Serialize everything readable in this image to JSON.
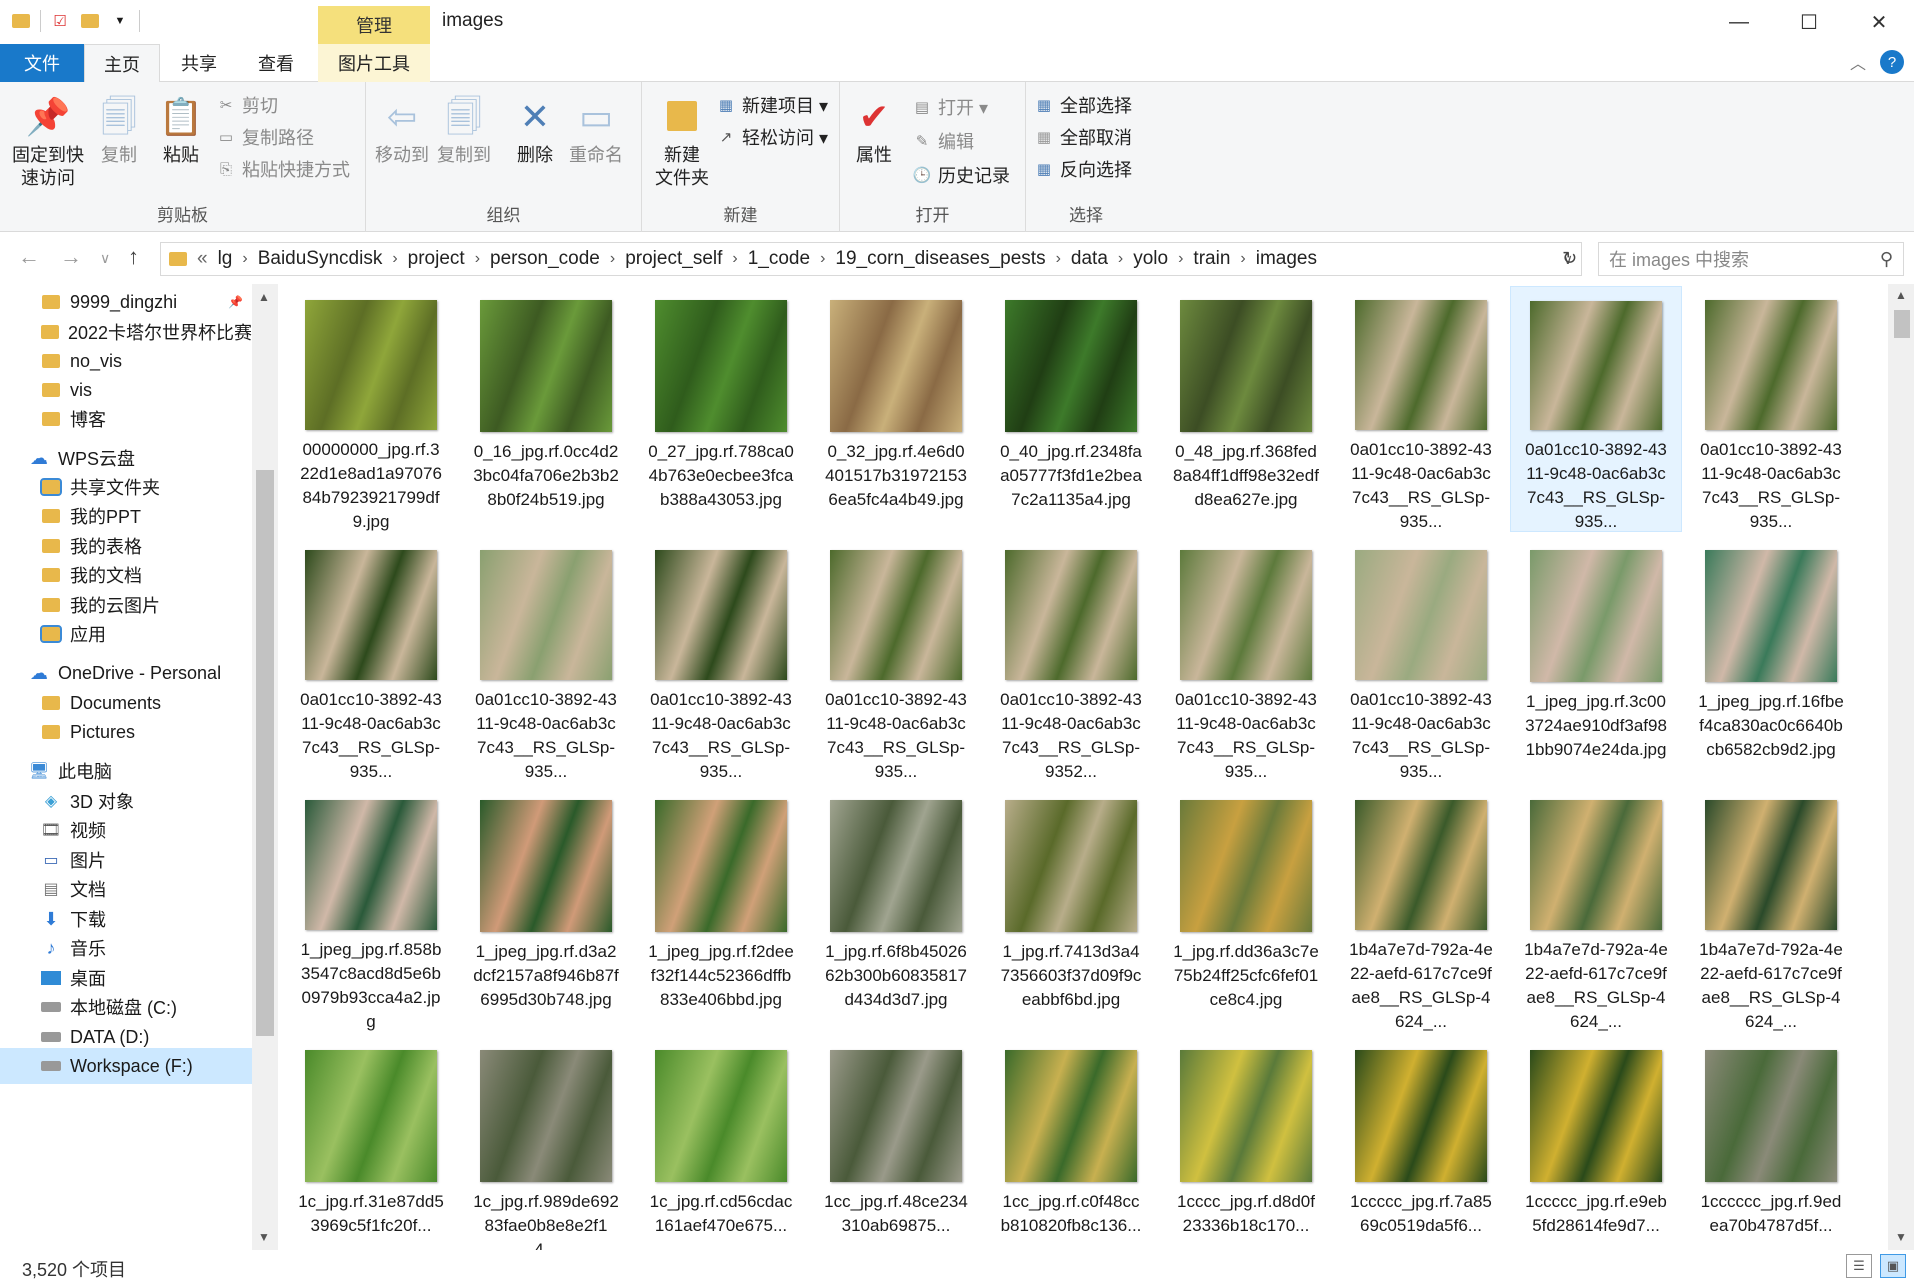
{
  "window": {
    "title": "images",
    "context_tab": "管理",
    "controls": {
      "minimize": "—",
      "maximize": "☐",
      "close": "✕"
    }
  },
  "quick_access_icons": [
    "folder-icon",
    "checkbox-icon",
    "folder-icon",
    "dropdown-icon"
  ],
  "tabs": [
    {
      "label": "文件",
      "active": false,
      "type": "file"
    },
    {
      "label": "主页",
      "active": true
    },
    {
      "label": "共享",
      "active": false
    },
    {
      "label": "查看",
      "active": false
    },
    {
      "label": "图片工具",
      "active": false
    }
  ],
  "ribbon": {
    "clipboard": {
      "title": "剪贴板",
      "pin": "固定到快\n速访问",
      "pin_line1": "固定到快",
      "pin_line2": "速访问",
      "copy": "复制",
      "paste": "粘贴",
      "cut": "剪切",
      "copy_path": "复制路径",
      "paste_shortcut": "粘贴快捷方式"
    },
    "organize": {
      "title": "组织",
      "move_to": "移动到",
      "copy_to": "复制到",
      "delete": "删除",
      "rename": "重命名"
    },
    "new": {
      "title": "新建",
      "new_folder_line1": "新建",
      "new_folder_line2": "文件夹",
      "new_item": "新建项目 ▾",
      "easy_access": "轻松访问 ▾"
    },
    "open": {
      "title": "打开",
      "properties": "属性",
      "open": "打开 ▾",
      "edit": "编辑",
      "history": "历史记录"
    },
    "select": {
      "title": "选择",
      "select_all": "全部选择",
      "select_none": "全部取消",
      "invert": "反向选择"
    }
  },
  "address": {
    "prefix": "«",
    "crumbs": [
      "lg",
      "BaiduSyncdisk",
      "project",
      "person_code",
      "project_self",
      "1_code",
      "19_corn_diseases_pests",
      "data",
      "yolo",
      "train",
      "images"
    ],
    "search_placeholder": "在 images 中搜索"
  },
  "nav": [
    {
      "label": "9999_dingzhi",
      "icon": "folder",
      "pinned": true,
      "indent": 1
    },
    {
      "label": "2022卡塔尔世界杯比赛",
      "icon": "folder",
      "indent": 1
    },
    {
      "label": "no_vis",
      "icon": "folder",
      "indent": 1
    },
    {
      "label": "vis",
      "icon": "folder",
      "indent": 1
    },
    {
      "label": "博客",
      "icon": "folder",
      "indent": 1
    },
    {
      "label": "WPS云盘",
      "icon": "cloud",
      "indent": 0
    },
    {
      "label": "共享文件夹",
      "icon": "shared",
      "indent": 1
    },
    {
      "label": "我的PPT",
      "icon": "folder",
      "indent": 1
    },
    {
      "label": "我的表格",
      "icon": "folder",
      "indent": 1
    },
    {
      "label": "我的文档",
      "icon": "folder",
      "indent": 1
    },
    {
      "label": "我的云图片",
      "icon": "folder",
      "indent": 1
    },
    {
      "label": "应用",
      "icon": "shared",
      "indent": 1
    },
    {
      "label": "OneDrive - Personal",
      "icon": "onedrive",
      "indent": 0
    },
    {
      "label": "Documents",
      "icon": "folder",
      "indent": 1
    },
    {
      "label": "Pictures",
      "icon": "folder",
      "indent": 1
    },
    {
      "label": "此电脑",
      "icon": "pc",
      "indent": 0
    },
    {
      "label": "3D 对象",
      "icon": "cube",
      "indent": 1
    },
    {
      "label": "视频",
      "icon": "video",
      "indent": 1
    },
    {
      "label": "图片",
      "icon": "picture",
      "indent": 1
    },
    {
      "label": "文档",
      "icon": "doc",
      "indent": 1
    },
    {
      "label": "下载",
      "icon": "download",
      "indent": 1
    },
    {
      "label": "音乐",
      "icon": "music",
      "indent": 1
    },
    {
      "label": "桌面",
      "icon": "desktop",
      "indent": 1
    },
    {
      "label": "本地磁盘 (C:)",
      "icon": "drive",
      "indent": 1
    },
    {
      "label": "DATA (D:)",
      "icon": "drive",
      "indent": 1
    },
    {
      "label": "Workspace (F:)",
      "icon": "drive",
      "indent": 1,
      "selected": true
    }
  ],
  "files": [
    {
      "name": "00000000_jpg.rf.322d1e8ad1a9707684b7923921799df9.jpg",
      "c1": "#8fa63a",
      "c2": "#5d6e25"
    },
    {
      "name": "0_16_jpg.rf.0cc4d23bc04fa706e2b3b28b0f24b519.jpg",
      "c1": "#6a9a3a",
      "c2": "#3d5a22"
    },
    {
      "name": "0_27_jpg.rf.788ca04b763e0ecbee3fcab388a43053.jpg",
      "c1": "#4f8d2e",
      "c2": "#2f5c1c"
    },
    {
      "name": "0_32_jpg.rf.4e6d0401517b319721536ea5fc4a4b49.jpg",
      "c1": "#c9b07a",
      "c2": "#8a6a45"
    },
    {
      "name": "0_40_jpg.rf.2348faa05777f3fd1e2bea7c2a1135a4.jpg",
      "c1": "#3d7a2a",
      "c2": "#203e14"
    },
    {
      "name": "0_48_jpg.rf.368fed8a84ff1dff98e32edfd8ea627e.jpg",
      "c1": "#6d8a3e",
      "c2": "#3c4d24"
    },
    {
      "name": "0a01cc10-3892-4311-9c48-0ac6ab3c7c43__RS_GLSp-935...",
      "c1": "#4d6a2c",
      "c2": "#c9b69a"
    },
    {
      "name": "0a01cc10-3892-4311-9c48-0ac6ab3c7c43__RS_GLSp-935...",
      "c1": "#4d6a2c",
      "c2": "#c9b69a",
      "selected": true
    },
    {
      "name": "0a01cc10-3892-4311-9c48-0ac6ab3c7c43__RS_GLSp-935...",
      "c1": "#4d6a2c",
      "c2": "#c9b69a"
    },
    {
      "name": "0a01cc10-3892-4311-9c48-0ac6ab3c7c43__RS_GLSp-935...",
      "c1": "#2d4a1c",
      "c2": "#c9b69a"
    },
    {
      "name": "0a01cc10-3892-4311-9c48-0ac6ab3c7c43__RS_GLSp-935...",
      "c1": "#8aa070",
      "c2": "#c9b69a"
    },
    {
      "name": "0a01cc10-3892-4311-9c48-0ac6ab3c7c43__RS_GLSp-935...",
      "c1": "#2d4a1c",
      "c2": "#c9b69a"
    },
    {
      "name": "0a01cc10-3892-4311-9c48-0ac6ab3c7c43__RS_GLSp-935...",
      "c1": "#4d6a2c",
      "c2": "#c9b69a"
    },
    {
      "name": "0a01cc10-3892-4311-9c48-0ac6ab3c7c43__RS_GLSp-9352...",
      "c1": "#4d6a2c",
      "c2": "#c9b69a"
    },
    {
      "name": "0a01cc10-3892-4311-9c48-0ac6ab3c7c43__RS_GLSp-935...",
      "c1": "#5d7a3c",
      "c2": "#c9b69a"
    },
    {
      "name": "0a01cc10-3892-4311-9c48-0ac6ab3c7c43__RS_GLSp-935...",
      "c1": "#9aaa80",
      "c2": "#c9b69a"
    },
    {
      "name": "1_jpeg_jpg.rf.3c003724ae910df3af981bb9074e24da.jpg",
      "c1": "#7a9a6a",
      "c2": "#d0b8a8"
    },
    {
      "name": "1_jpeg_jpg.rf.16fbef4ca830ac0c6640bcb6582cb9d2.jpg",
      "c1": "#3a7a5a",
      "c2": "#d0b8a8"
    },
    {
      "name": "1_jpeg_jpg.rf.858b3547c8acd8d5e6b0979b93cca4a2.jpg",
      "c1": "#2a5a3a",
      "c2": "#d0b8a8"
    },
    {
      "name": "1_jpeg_jpg.rf.d3a2dcf2157a8f946b87f6995d30b748.jpg",
      "c1": "#2a5a2a",
      "c2": "#d09a78"
    },
    {
      "name": "1_jpeg_jpg.rf.f2deef32f144c52366dffb833e406bbd.jpg",
      "c1": "#3a6a2a",
      "c2": "#d0a078"
    },
    {
      "name": "1_jpg.rf.6f8b4502662b300b60835817d434d3d7.jpg",
      "c1": "#a0a490",
      "c2": "#4a5a3a"
    },
    {
      "name": "1_jpg.rf.7413d3a47356603f37d09f9ceabbf6bd.jpg",
      "c1": "#b8ad8a",
      "c2": "#5a6a2a"
    },
    {
      "name": "1_jpg.rf.dd36a3c7e75b24ff25cfc6fef01ce8c4.jpg",
      "c1": "#6a7a3a",
      "c2": "#c8a040"
    },
    {
      "name": "1b4a7e7d-792a-4e22-aefd-617c7ce9fae8__RS_GLSp-4624_...",
      "c1": "#3a5a2a",
      "c2": "#d0b070"
    },
    {
      "name": "1b4a7e7d-792a-4e22-aefd-617c7ce9fae8__RS_GLSp-4624_...",
      "c1": "#4a6a3a",
      "c2": "#d0b070"
    },
    {
      "name": "1b4a7e7d-792a-4e22-aefd-617c7ce9fae8__RS_GLSp-4624_...",
      "c1": "#2a4a2a",
      "c2": "#d0b070"
    },
    {
      "name": "1c_jpg.rf.31e87dd53969c5f1fc20f...",
      "c1": "#4a8a2a",
      "c2": "#9ac060"
    },
    {
      "name": "1c_jpg.rf.989de69283fae0b8e8e2f14...",
      "c1": "#8a8a78",
      "c2": "#4a5a3a"
    },
    {
      "name": "1c_jpg.rf.cd56cdac161aef470e675...",
      "c1": "#4a8a2a",
      "c2": "#9ac060"
    },
    {
      "name": "1cc_jpg.rf.48ce234310ab69875...",
      "c1": "#9a9a8a",
      "c2": "#4a5a3a"
    },
    {
      "name": "1cc_jpg.rf.c0f48ccb810820fb8c136...",
      "c1": "#3a6a2a",
      "c2": "#c8b050"
    },
    {
      "name": "1cccc_jpg.rf.d8d0f23336b18c170...",
      "c1": "#5a7a3a",
      "c2": "#d0c040"
    },
    {
      "name": "1ccccc_jpg.rf.7a8569c0519da5f6...",
      "c1": "#2a4a1a",
      "c2": "#d0b030"
    },
    {
      "name": "1ccccc_jpg.rf.e9eb5fd28614fe9d7...",
      "c1": "#2a4a1a",
      "c2": "#d0b030"
    },
    {
      "name": "1cccccc_jpg.rf.9edea70b4787d5f...",
      "c1": "#8a8a78",
      "c2": "#4a6a3a"
    }
  ],
  "status": {
    "count": "3,520 个项目"
  }
}
